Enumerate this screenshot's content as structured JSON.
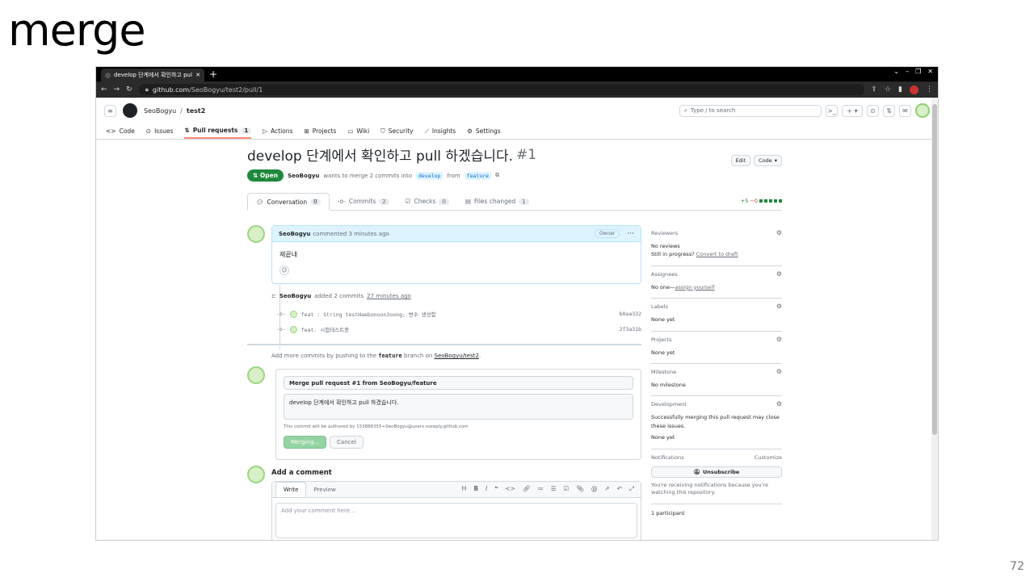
{
  "slide": {
    "title": "merge",
    "number": "72"
  },
  "browser": {
    "tab_title": "develop 단계에서 확인하고 pull",
    "new_tab": "+",
    "url_host": "github.com",
    "url_path": "/SeoBogyu/test2/pull/1"
  },
  "header": {
    "owner": "SeoBogyu",
    "sep": "/",
    "repo": "test2",
    "search_placeholder": "Type / to search"
  },
  "repo_nav": [
    {
      "label": "Code"
    },
    {
      "label": "Issues"
    },
    {
      "label": "Pull requests",
      "count": "1"
    },
    {
      "label": "Actions"
    },
    {
      "label": "Projects"
    },
    {
      "label": "Wiki"
    },
    {
      "label": "Security"
    },
    {
      "label": "Insights"
    },
    {
      "label": "Settings"
    }
  ],
  "pr": {
    "title": "develop 단계에서 확인하고 pull 하겠습니다.",
    "number": "#1",
    "status": "Open",
    "author": "SeoBogyu",
    "meta_mid": "wants to merge 2 commits into",
    "base": "develop",
    "from": "from",
    "head": "feature",
    "edit_label": "Edit",
    "code_label": "Code"
  },
  "pr_tabs": [
    {
      "label": "Conversation",
      "count": "0"
    },
    {
      "label": "Commits",
      "count": "2"
    },
    {
      "label": "Checks",
      "count": "0"
    },
    {
      "label": "Files changed",
      "count": "1"
    }
  ],
  "diffstat": {
    "add": "+5",
    "del": "−0"
  },
  "comment": {
    "author": "SeoBogyu",
    "time": "commented 3 minutes ago",
    "badge": "Owner",
    "body": "제끝내"
  },
  "commits_event": {
    "author": "SeoBogyu",
    "text": "added 2 commits",
    "time": "27 minutes ago"
  },
  "commits": [
    {
      "msg": "feat : String testHaebonuon3oong; 변수 생성함",
      "sha": "b0aa332"
    },
    {
      "msg": "feat. 시험테스트중",
      "sha": "2f3a31b"
    }
  ],
  "push_msg": {
    "pre": "Add more commits by pushing to the",
    "branch": "feature",
    "mid": "branch on",
    "repo": "SeoBogyu/test2",
    "end": "."
  },
  "merge": {
    "title": "Merge pull request #1 from SeoBogyu/feature",
    "body": "develop 단계에서 확인하고 pull 하겠습니다.",
    "authored": "This commit will be authored by 153888355+SeoBogyu@users.noreply.github.com",
    "merging": "Merging...",
    "cancel": "Cancel"
  },
  "add_comment": {
    "title": "Add a comment",
    "write": "Write",
    "preview": "Preview",
    "placeholder": "Add your comment here..."
  },
  "sidebar": {
    "reviewers": "Reviewers",
    "no_reviews": "No reviews",
    "still": "Still in progress?",
    "convert": "Convert to draft",
    "assignees": "Assignees",
    "no_one": "No one—",
    "assign": "assign yourself",
    "labels": "Labels",
    "none_yet": "None yet",
    "projects": "Projects",
    "milestone": "Milestone",
    "no_milestone": "No milestone",
    "development": "Development",
    "dev_text": "Successfully merging this pull request may close these issues.",
    "notifications": "Notifications",
    "customize": "Customize",
    "unsubscribe": "Unsubscribe",
    "notif_text": "You're receiving notifications because you're watching this repository.",
    "participants": "1 participant"
  }
}
